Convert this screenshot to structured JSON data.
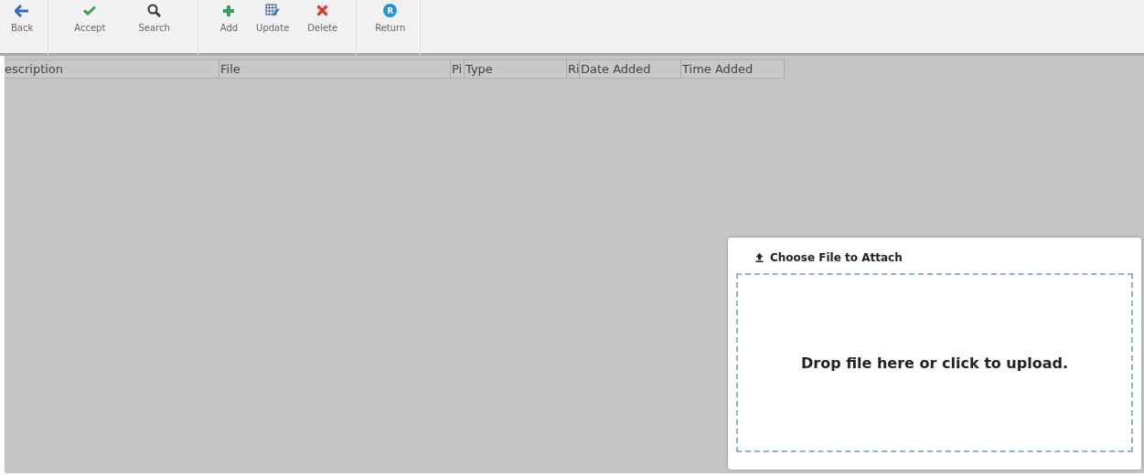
{
  "toolbar": {
    "groups": [
      [
        {
          "kind": "back",
          "label": "Back"
        }
      ],
      [
        {
          "kind": "accept",
          "label": "Accept"
        },
        {
          "kind": "search",
          "label": "Search"
        }
      ],
      [
        {
          "kind": "add",
          "label": "Add"
        },
        {
          "kind": "update",
          "label": "Update"
        },
        {
          "kind": "delete",
          "label": "Delete"
        }
      ],
      [
        {
          "kind": "return",
          "label": "Return",
          "badge": "R"
        }
      ]
    ]
  },
  "table": {
    "columns": [
      "escription",
      "File",
      "Pi",
      "Type",
      "Ri",
      "Date Added",
      "Time Added"
    ]
  },
  "upload": {
    "title": "Choose File to Attach",
    "dropzone": "Drop file here or click to upload."
  }
}
